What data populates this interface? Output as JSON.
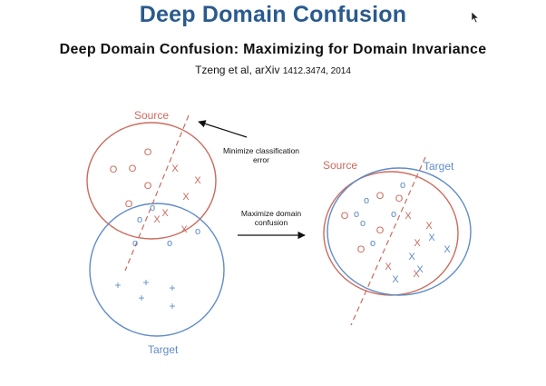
{
  "slide": {
    "title": "Deep Domain Confusion",
    "subtitle": "Deep Domain Confusion: Maximizing for Domain Invariance",
    "citation_main": "Tzeng et al, arXiv ",
    "citation_small": "1412.3474, 2014"
  },
  "figure": {
    "colors": {
      "source": "#cc6a5c",
      "target": "#5f8cc6",
      "ink": "#111111"
    },
    "labels": {
      "source_left": "Source",
      "target_left": "Target",
      "source_right": "Source",
      "target_right": "Target",
      "annotation_classification": [
        "Minimize classification",
        "error"
      ],
      "annotation_domain": [
        "Maximize domain",
        "confusion"
      ]
    },
    "markers": {
      "left_source_o": "O",
      "left_source_x": "X",
      "left_target_o": "o",
      "left_target_x": "+",
      "right_source_o": "O",
      "right_source_x": "X",
      "right_target_o": "o",
      "right_target_x": "X"
    }
  }
}
